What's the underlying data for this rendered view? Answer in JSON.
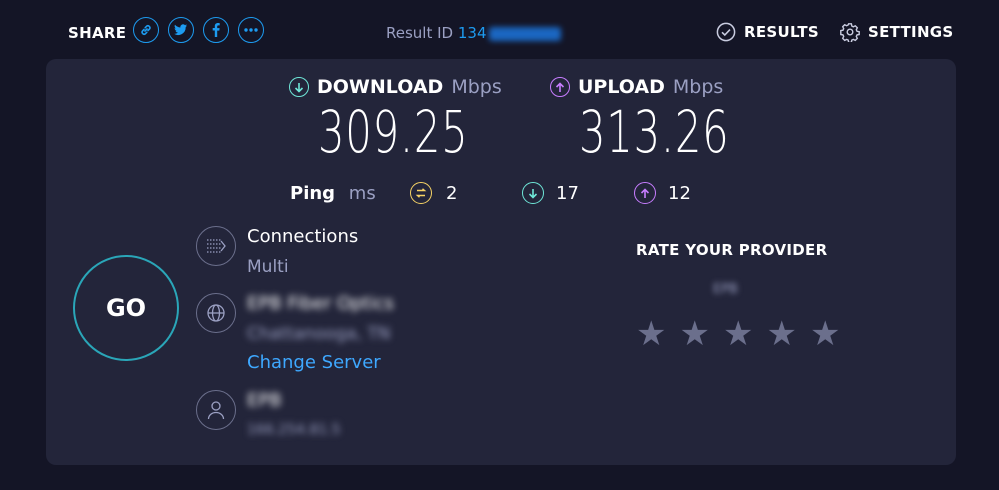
{
  "header": {
    "share_label": "SHARE",
    "share_icons": [
      "link-icon",
      "twitter-icon",
      "facebook-icon",
      "more-icon"
    ],
    "result_id_label": "Result ID",
    "result_id_value": "134",
    "results_label": "RESULTS",
    "settings_label": "SETTINGS"
  },
  "download": {
    "label": "DOWNLOAD",
    "unit": "Mbps",
    "value": "309.25",
    "color": "#6fe7d8"
  },
  "upload": {
    "label": "UPLOAD",
    "unit": "Mbps",
    "value": "313.26",
    "color": "#c77dff"
  },
  "ping": {
    "label": "Ping",
    "unit": "ms",
    "idle": "2",
    "download": "17",
    "upload": "12",
    "idle_color": "#f6d365"
  },
  "go_label": "GO",
  "connections": {
    "title": "Connections",
    "value": "Multi"
  },
  "server": {
    "name": "EPB Fiber Optics",
    "location": "Chattanooga, TN",
    "change_label": "Change Server"
  },
  "provider": {
    "name": "EPB",
    "ip": "166.254.81.5"
  },
  "rating": {
    "title": "RATE YOUR PROVIDER",
    "provider_name": "EPB",
    "stars": 5
  }
}
